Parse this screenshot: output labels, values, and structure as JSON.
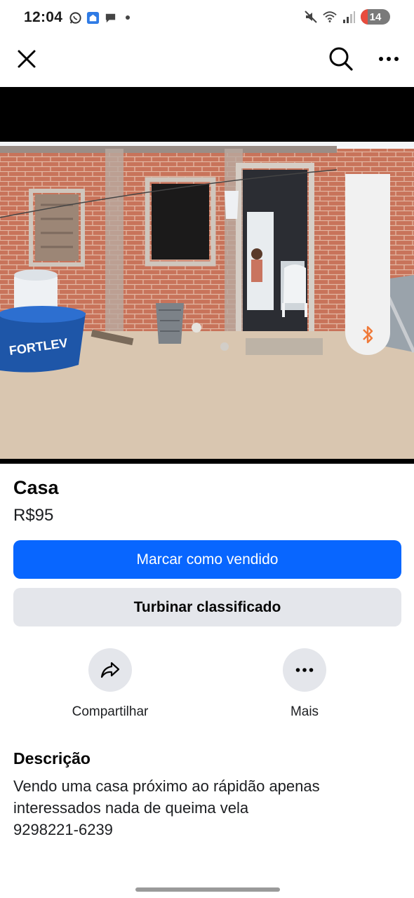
{
  "status_bar": {
    "time": "12:04",
    "battery_level": "14",
    "icons": [
      "whatsapp-icon",
      "app-notification-icon",
      "chat-bubble-icon",
      "dot-icon",
      "mute-icon",
      "wifi-icon",
      "signal-icon",
      "battery-icon"
    ]
  },
  "nav": {
    "close_icon": "close-icon",
    "search_icon": "search-icon",
    "more_icon": "more-horizontal-icon"
  },
  "media": {
    "photo_text": "FORTLEV",
    "scroll_icon": "bluetooth-icon"
  },
  "listing": {
    "title": "Casa",
    "price": "R$95"
  },
  "buttons": {
    "mark_sold": "Marcar como vendido",
    "boost": "Turbinar classificado"
  },
  "actions": {
    "share": "Compartilhar",
    "more": "Mais"
  },
  "description": {
    "heading": "Descrição",
    "text": "Vendo uma casa próximo ao rápidão apenas\ninteressados nada de queima vela\n9298221-6239"
  },
  "colors": {
    "primary": "#0866ff",
    "secondary_bg": "#e4e6eb",
    "scroll_icon": "#f07a3a"
  }
}
